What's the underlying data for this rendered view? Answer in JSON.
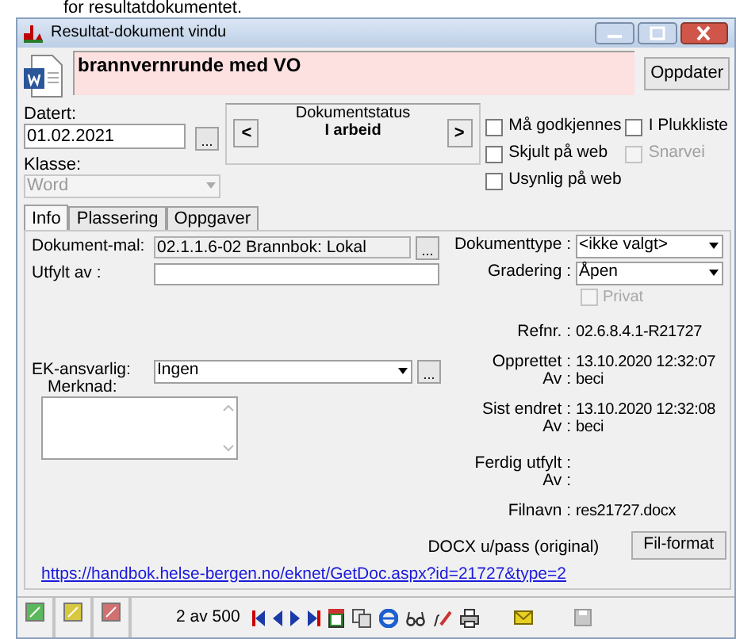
{
  "caption": "for resultatdokumentet.",
  "window": {
    "title": "Resultat-dokument vindu"
  },
  "document_title": "brannvernrunde med VO",
  "update_button": "Oppdater",
  "dated": {
    "label": "Datert:",
    "value": "01.02.2021",
    "picker": "..."
  },
  "status": {
    "label": "Dokumentstatus",
    "value": "I arbeid",
    "prev": "<",
    "next": ">"
  },
  "checkboxes": [
    {
      "label": "Må godkjennes",
      "checked": false,
      "disabled": false
    },
    {
      "label": "I Plukkliste",
      "checked": false,
      "disabled": false
    },
    {
      "label": "Skjult på web",
      "checked": false,
      "disabled": false
    },
    {
      "label": "Snarvei",
      "checked": false,
      "disabled": true
    },
    {
      "label": "Usynlig på web",
      "checked": false,
      "disabled": false
    }
  ],
  "class": {
    "label": "Klasse:",
    "value": "Word",
    "disabled": true
  },
  "tabs": [
    {
      "label": "Info",
      "selected": true
    },
    {
      "label": "Plassering",
      "selected": false
    },
    {
      "label": "Oppgaver",
      "selected": false
    }
  ],
  "template": {
    "label": "Dokument-mal:",
    "value": "02.1.1.6-02 Brannbok: Lokal",
    "picker": "..."
  },
  "filled_by": {
    "label": "Utfylt av :"
  },
  "ek_responsible": {
    "label": "EK-ansvarlig:",
    "value": "Ingen",
    "picker": "..."
  },
  "remark": {
    "label": "Merknad:"
  },
  "document_type": {
    "label": "Dokumenttype :",
    "value": "<ikke valgt>"
  },
  "grading": {
    "label": "Gradering :",
    "value": "Åpen"
  },
  "private": {
    "label": "Privat",
    "checked": false,
    "disabled": true
  },
  "info_groups": [
    [
      {
        "label": "Refnr. :",
        "value": "02.6.8.4.1-R21727"
      }
    ],
    [
      {
        "label": "Opprettet :",
        "value": "13.10.2020 12:32:07"
      },
      {
        "label": "Av :",
        "value": "beci"
      }
    ],
    [
      {
        "label": "Sist endret :",
        "value": "13.10.2020 12:32:08"
      },
      {
        "label": "Av :",
        "value": "beci"
      }
    ],
    [
      {
        "label": "Ferdig utfylt :"
      },
      {
        "label": "Av :"
      }
    ],
    [
      {
        "label": "Filnavn :",
        "value": "res21727.docx"
      }
    ]
  ],
  "format_note": "DOCX u/pass (original)",
  "format_button": "Fil-format",
  "link": "https://handbok.helse-bergen.no/eknet/GetDoc.aspx?id=21727&type=2",
  "toolbar": {
    "counter": "2 av 500"
  }
}
